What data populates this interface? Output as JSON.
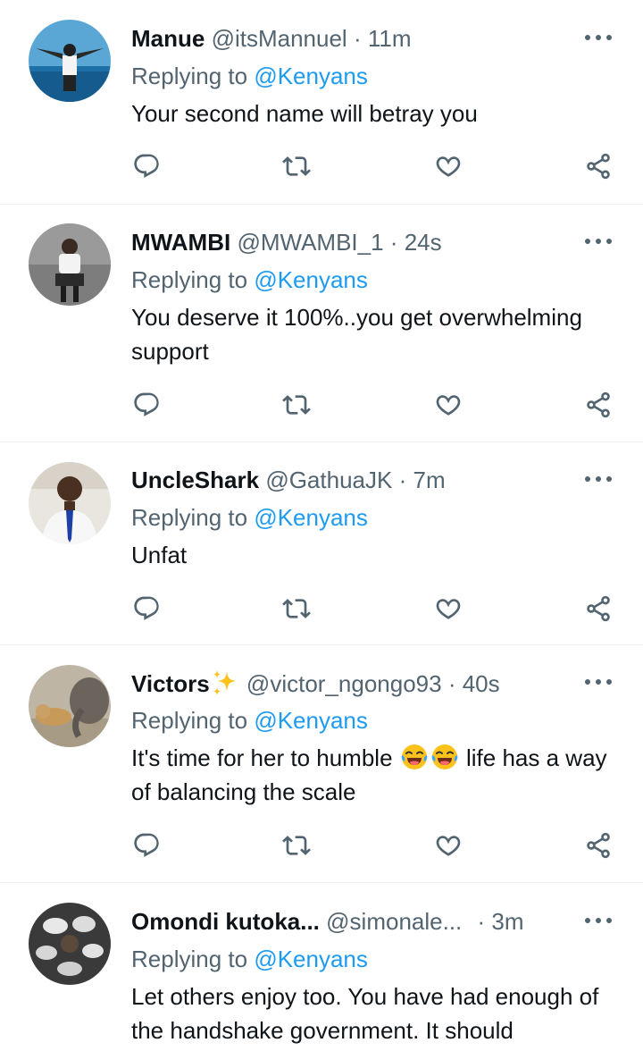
{
  "tweets": [
    {
      "name": "Manue",
      "handle": "@itsMannuel",
      "time": "11m",
      "replying_prefix": "Replying to",
      "replying_to": "@Kenyans",
      "text": "Your second name will betray you"
    },
    {
      "name": "MWAMBI",
      "handle": "@MWAMBI_1",
      "time": "24s",
      "replying_prefix": "Replying to",
      "replying_to": "@Kenyans",
      "text": "You deserve it 100%..you get overwhelming support"
    },
    {
      "name": "UncleShark",
      "handle": "@GathuaJK",
      "time": "7m",
      "replying_prefix": "Replying to",
      "replying_to": "@Kenyans",
      "text": "Unfat"
    },
    {
      "name": "Victors",
      "handle": "@victor_ngongo93",
      "time": "40s",
      "replying_prefix": "Replying to",
      "replying_to": "@Kenyans",
      "text_before": "It's time for her to humble",
      "text_after": "life has a way of balancing the scale"
    },
    {
      "name": "Omondi kutoka...",
      "handle": "@simonale...",
      "time": "3m",
      "replying_prefix": "Replying to",
      "replying_to": "@Kenyans",
      "text": "Let others enjoy too. You have had enough of the handshake government. It should"
    }
  ],
  "separator": "·",
  "icons": {
    "reply": "reply-icon",
    "retweet": "retweet-icon",
    "like": "heart-icon",
    "share": "share-icon",
    "more": "more-icon"
  },
  "colors": {
    "text": "#0f1419",
    "secondary": "#536471",
    "mention": "#1d9bf0",
    "divider": "#eff3f4"
  }
}
